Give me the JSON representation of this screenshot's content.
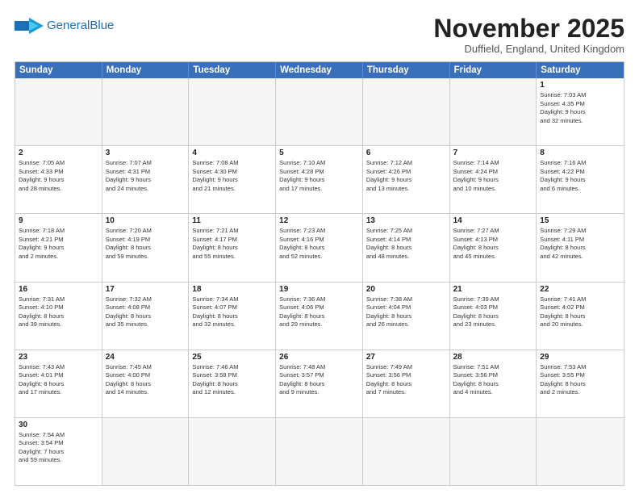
{
  "logo": {
    "line1": "General",
    "line2": "Blue"
  },
  "title": "November 2025",
  "location": "Duffield, England, United Kingdom",
  "days_of_week": [
    "Sunday",
    "Monday",
    "Tuesday",
    "Wednesday",
    "Thursday",
    "Friday",
    "Saturday"
  ],
  "weeks": [
    [
      {
        "day": "",
        "info": ""
      },
      {
        "day": "",
        "info": ""
      },
      {
        "day": "",
        "info": ""
      },
      {
        "day": "",
        "info": ""
      },
      {
        "day": "",
        "info": ""
      },
      {
        "day": "",
        "info": ""
      },
      {
        "day": "1",
        "info": "Sunrise: 7:03 AM\nSunset: 4:35 PM\nDaylight: 9 hours\nand 32 minutes."
      }
    ],
    [
      {
        "day": "2",
        "info": "Sunrise: 7:05 AM\nSunset: 4:33 PM\nDaylight: 9 hours\nand 28 minutes."
      },
      {
        "day": "3",
        "info": "Sunrise: 7:07 AM\nSunset: 4:31 PM\nDaylight: 9 hours\nand 24 minutes."
      },
      {
        "day": "4",
        "info": "Sunrise: 7:08 AM\nSunset: 4:30 PM\nDaylight: 9 hours\nand 21 minutes."
      },
      {
        "day": "5",
        "info": "Sunrise: 7:10 AM\nSunset: 4:28 PM\nDaylight: 9 hours\nand 17 minutes."
      },
      {
        "day": "6",
        "info": "Sunrise: 7:12 AM\nSunset: 4:26 PM\nDaylight: 9 hours\nand 13 minutes."
      },
      {
        "day": "7",
        "info": "Sunrise: 7:14 AM\nSunset: 4:24 PM\nDaylight: 9 hours\nand 10 minutes."
      },
      {
        "day": "8",
        "info": "Sunrise: 7:16 AM\nSunset: 4:22 PM\nDaylight: 9 hours\nand 6 minutes."
      }
    ],
    [
      {
        "day": "9",
        "info": "Sunrise: 7:18 AM\nSunset: 4:21 PM\nDaylight: 9 hours\nand 2 minutes."
      },
      {
        "day": "10",
        "info": "Sunrise: 7:20 AM\nSunset: 4:19 PM\nDaylight: 8 hours\nand 59 minutes."
      },
      {
        "day": "11",
        "info": "Sunrise: 7:21 AM\nSunset: 4:17 PM\nDaylight: 8 hours\nand 55 minutes."
      },
      {
        "day": "12",
        "info": "Sunrise: 7:23 AM\nSunset: 4:16 PM\nDaylight: 8 hours\nand 52 minutes."
      },
      {
        "day": "13",
        "info": "Sunrise: 7:25 AM\nSunset: 4:14 PM\nDaylight: 8 hours\nand 48 minutes."
      },
      {
        "day": "14",
        "info": "Sunrise: 7:27 AM\nSunset: 4:13 PM\nDaylight: 8 hours\nand 45 minutes."
      },
      {
        "day": "15",
        "info": "Sunrise: 7:29 AM\nSunset: 4:11 PM\nDaylight: 8 hours\nand 42 minutes."
      }
    ],
    [
      {
        "day": "16",
        "info": "Sunrise: 7:31 AM\nSunset: 4:10 PM\nDaylight: 8 hours\nand 39 minutes."
      },
      {
        "day": "17",
        "info": "Sunrise: 7:32 AM\nSunset: 4:08 PM\nDaylight: 8 hours\nand 35 minutes."
      },
      {
        "day": "18",
        "info": "Sunrise: 7:34 AM\nSunset: 4:07 PM\nDaylight: 8 hours\nand 32 minutes."
      },
      {
        "day": "19",
        "info": "Sunrise: 7:36 AM\nSunset: 4:06 PM\nDaylight: 8 hours\nand 29 minutes."
      },
      {
        "day": "20",
        "info": "Sunrise: 7:38 AM\nSunset: 4:04 PM\nDaylight: 8 hours\nand 26 minutes."
      },
      {
        "day": "21",
        "info": "Sunrise: 7:39 AM\nSunset: 4:03 PM\nDaylight: 8 hours\nand 23 minutes."
      },
      {
        "day": "22",
        "info": "Sunrise: 7:41 AM\nSunset: 4:02 PM\nDaylight: 8 hours\nand 20 minutes."
      }
    ],
    [
      {
        "day": "23",
        "info": "Sunrise: 7:43 AM\nSunset: 4:01 PM\nDaylight: 8 hours\nand 17 minutes."
      },
      {
        "day": "24",
        "info": "Sunrise: 7:45 AM\nSunset: 4:00 PM\nDaylight: 8 hours\nand 14 minutes."
      },
      {
        "day": "25",
        "info": "Sunrise: 7:46 AM\nSunset: 3:58 PM\nDaylight: 8 hours\nand 12 minutes."
      },
      {
        "day": "26",
        "info": "Sunrise: 7:48 AM\nSunset: 3:57 PM\nDaylight: 8 hours\nand 9 minutes."
      },
      {
        "day": "27",
        "info": "Sunrise: 7:49 AM\nSunset: 3:56 PM\nDaylight: 8 hours\nand 7 minutes."
      },
      {
        "day": "28",
        "info": "Sunrise: 7:51 AM\nSunset: 3:56 PM\nDaylight: 8 hours\nand 4 minutes."
      },
      {
        "day": "29",
        "info": "Sunrise: 7:53 AM\nSunset: 3:55 PM\nDaylight: 8 hours\nand 2 minutes."
      }
    ],
    [
      {
        "day": "30",
        "info": "Sunrise: 7:54 AM\nSunset: 3:54 PM\nDaylight: 7 hours\nand 59 minutes."
      },
      {
        "day": "",
        "info": ""
      },
      {
        "day": "",
        "info": ""
      },
      {
        "day": "",
        "info": ""
      },
      {
        "day": "",
        "info": ""
      },
      {
        "day": "",
        "info": ""
      },
      {
        "day": "",
        "info": ""
      }
    ]
  ]
}
